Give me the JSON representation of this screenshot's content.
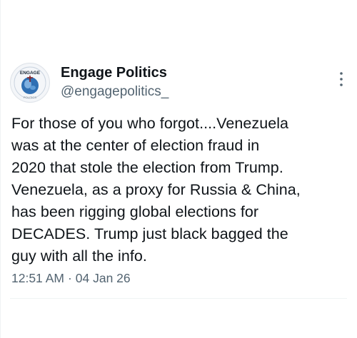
{
  "author": {
    "display_name": "Engage Politics",
    "handle": "@engagepolitics_",
    "avatar_text": "ENGAGE",
    "avatar_subtext": "POLITICS"
  },
  "tweet": {
    "text": "For those of you who forgot....Venezuela\nwas at the center of election fraud in\n2020 that stole the election from Trump.\nVenezuela, as a proxy for Russia & China,\nhas been rigging global elections for\nDECADES. Trump just black bagged the\nguy with all the info."
  },
  "meta": {
    "time": "12:51 AM",
    "separator": "·",
    "date": "04 Jan 26"
  },
  "icons": {
    "more": "more-vertical-icon"
  },
  "colors": {
    "text_primary": "#0f1419",
    "text_secondary": "#536471",
    "divider": "#eff3f4",
    "avatar_accent": "#2f6fb3"
  }
}
